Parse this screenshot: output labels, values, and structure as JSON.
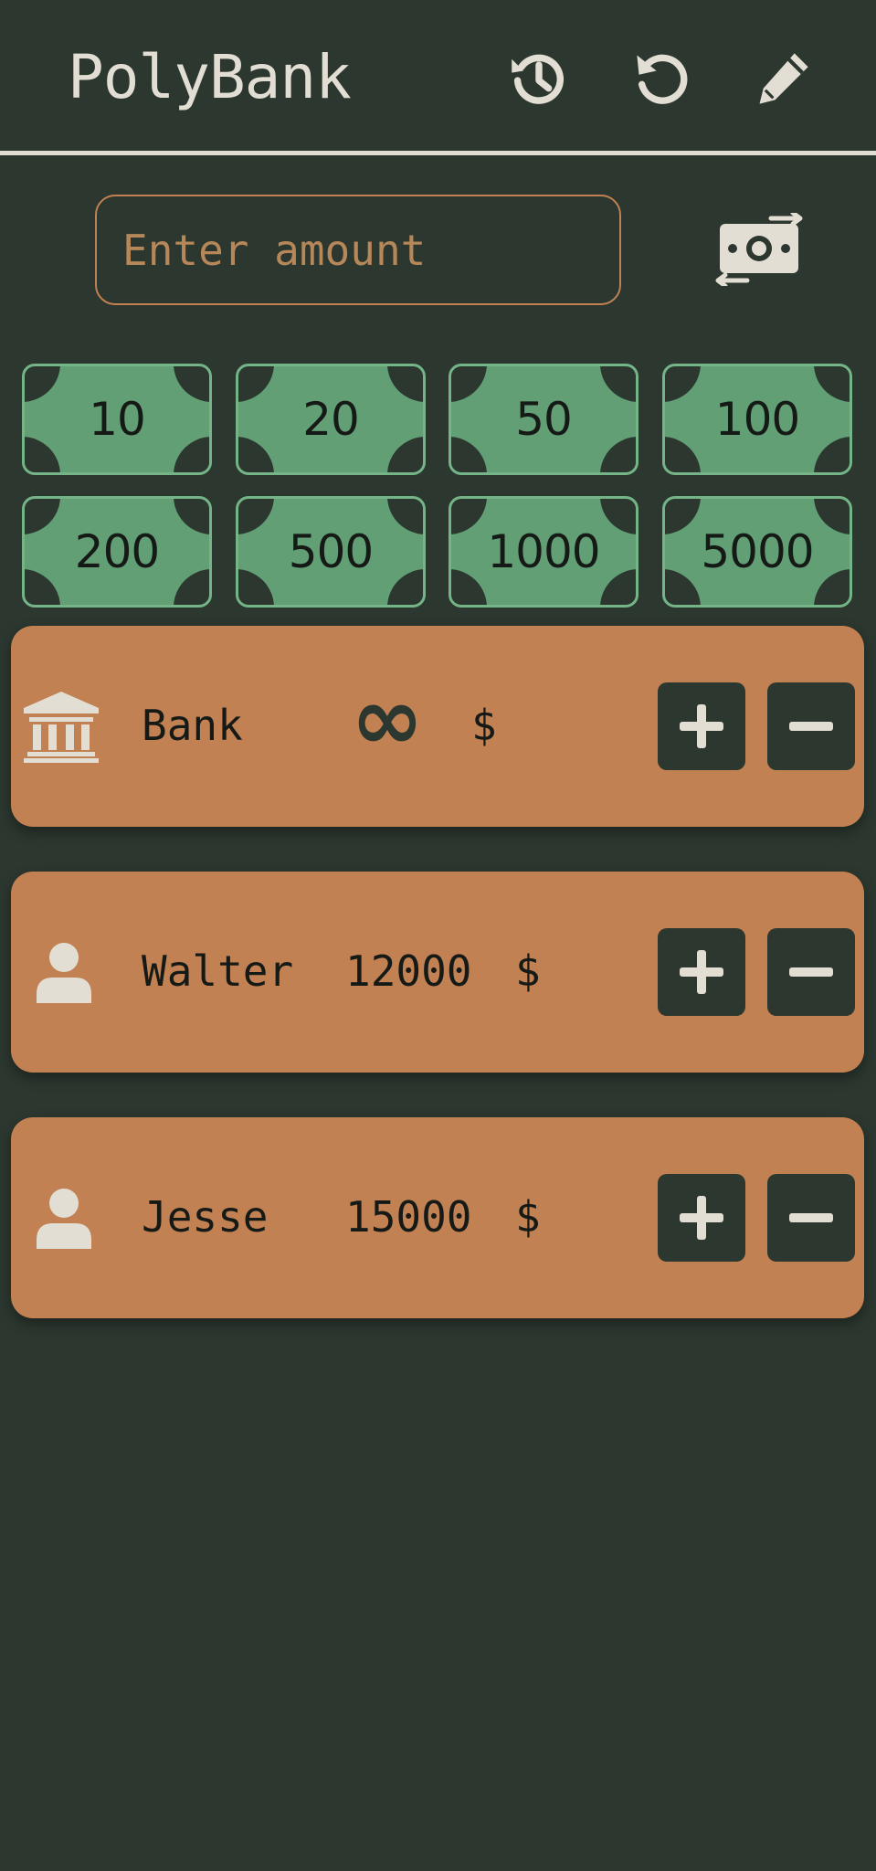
{
  "header": {
    "title": "PolyBank",
    "icons": [
      "history-icon",
      "undo-icon",
      "edit-icon"
    ]
  },
  "amount": {
    "placeholder": "Enter amount",
    "value": "",
    "action_icon": "money-transfer-icon"
  },
  "bills": [
    "10",
    "20",
    "50",
    "100",
    "200",
    "500",
    "1000",
    "5000"
  ],
  "players": [
    {
      "name": "Bank",
      "icon": "bank-icon",
      "balance": "∞",
      "currency": "$"
    },
    {
      "name": "Walter",
      "icon": "user-icon",
      "balance": "12000",
      "currency": "$"
    },
    {
      "name": "Jesse",
      "icon": "user-icon",
      "balance": "15000",
      "currency": "$"
    }
  ],
  "colors": {
    "background": "#2b372f",
    "foreground": "#e3ded3",
    "accent": "#c28152",
    "bill": "#639f75",
    "text_dark": "#161a17"
  }
}
